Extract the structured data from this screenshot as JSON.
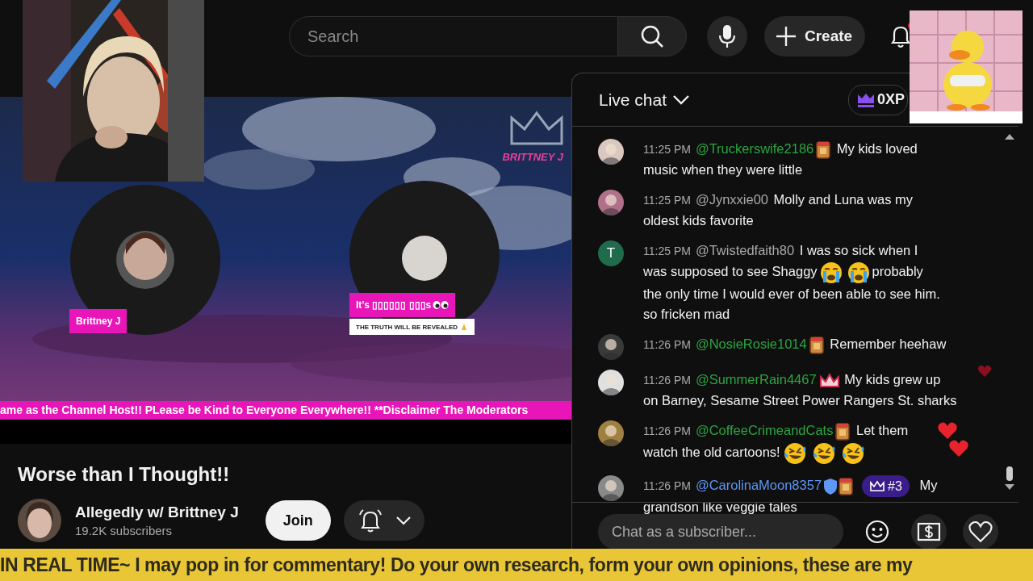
{
  "topbar": {
    "search": {
      "placeholder": "Search"
    },
    "create_label": "Create",
    "has_unread": true
  },
  "video": {
    "kind": "picture",
    "host_overlay": "BRITTNEY J",
    "name_tag": "Brittney J",
    "guest_tag": "It’s ▯▯▯▯▯▯ ▯▯▯s",
    "guest_subtitle": "THE TRUTH WILL BE REVEALED",
    "ticker": "ame as the Channel Host!! PLease be Kind to Everyone Everywhere!! **Disclaimer The Moderators"
  },
  "title": "Worse than I Thought!!",
  "channel": {
    "name": "Allegedly w/ Brittney J",
    "subscribers": "19.2K subscribers",
    "join_label": "Join"
  },
  "chat": {
    "title": "Live chat",
    "xp": "0XP",
    "messages": [
      {
        "avatar": {
          "kind": "picture"
        },
        "time": "11:25 PM",
        "author": "@Truckerswife2186",
        "color": "#2ba640",
        "badges": [
          {
            "kind": "sticker"
          }
        ],
        "lines": [
          [
            {
              "kind": "text",
              "text": "My kids loved"
            }
          ],
          [
            {
              "kind": "text",
              "text": "music when they were little"
            }
          ]
        ]
      },
      {
        "avatar": {
          "kind": "picture"
        },
        "time": "11:25 PM",
        "author": "@Jynxxie00",
        "color": "#aaaaaa",
        "lines": [
          [
            {
              "kind": "text",
              "text": "Molly and Luna was my"
            }
          ],
          [
            {
              "kind": "text",
              "text": "oldest kids favorite"
            }
          ]
        ]
      },
      {
        "avatar": {
          "kind": "letter",
          "text": "T",
          "color": "#1f6b4c"
        },
        "time": "11:25 PM",
        "author": "@Twistedfaith80",
        "color": "#aaaaaa",
        "lines": [
          [
            {
              "kind": "text",
              "text": "I was so sick when I"
            }
          ],
          [
            {
              "kind": "text",
              "text": "was supposed to see Shaggy"
            },
            {
              "kind": "cry"
            },
            {
              "kind": "cry"
            },
            {
              "kind": "text",
              "text": "probably"
            }
          ],
          [
            {
              "kind": "text",
              "text": "the only time I would ever of been able to see him."
            }
          ],
          [
            {
              "kind": "text",
              "text": "so fricken mad"
            }
          ]
        ]
      },
      {
        "avatar": {
          "kind": "picture"
        },
        "time": "11:26 PM",
        "author": "@NosieRosie1014",
        "color": "#2ba640",
        "badges": [
          {
            "kind": "sticker"
          }
        ],
        "lines": [
          [
            {
              "kind": "text",
              "text": "Remember heehaw"
            }
          ]
        ]
      },
      {
        "avatar": {
          "kind": "picture"
        },
        "time": "11:26 PM",
        "author": "@SummerRain4467",
        "color": "#2ba640",
        "badges": [
          {
            "kind": "crown-sticker"
          }
        ],
        "lines": [
          [
            {
              "kind": "text",
              "text": "My kids grew up"
            }
          ],
          [
            {
              "kind": "text",
              "text": "on Barney, Sesame Street Power Rangers St. sharks"
            }
          ]
        ]
      },
      {
        "avatar": {
          "kind": "picture"
        },
        "time": "11:26 PM",
        "author": "@CoffeeCrimeandCats",
        "color": "#2ba640",
        "badges": [
          {
            "kind": "sticker"
          }
        ],
        "lines": [
          [
            {
              "kind": "text",
              "text": "Let them"
            }
          ],
          [
            {
              "kind": "text",
              "text": "watch the old cartoons!"
            },
            {
              "kind": "laugh"
            },
            {
              "kind": "laugh"
            },
            {
              "kind": "laugh"
            }
          ]
        ]
      },
      {
        "avatar": {
          "kind": "picture"
        },
        "time": "11:26 PM",
        "author": "@CarolinaMoon8357",
        "color": "#5e97f6",
        "badges": [
          {
            "kind": "shield"
          },
          {
            "kind": "sticker"
          }
        ],
        "rank": "#3",
        "lines": [
          [
            {
              "kind": "text",
              "text": "My"
            }
          ],
          [
            {
              "kind": "text",
              "text": "grandson like veggie tales"
            }
          ]
        ]
      }
    ],
    "input_placeholder": "Chat as a subscriber..."
  },
  "bottom_ticker": "IN REAL TIME~ I may pop in for commentary! Do your own research, form your own opinions, these are my"
}
